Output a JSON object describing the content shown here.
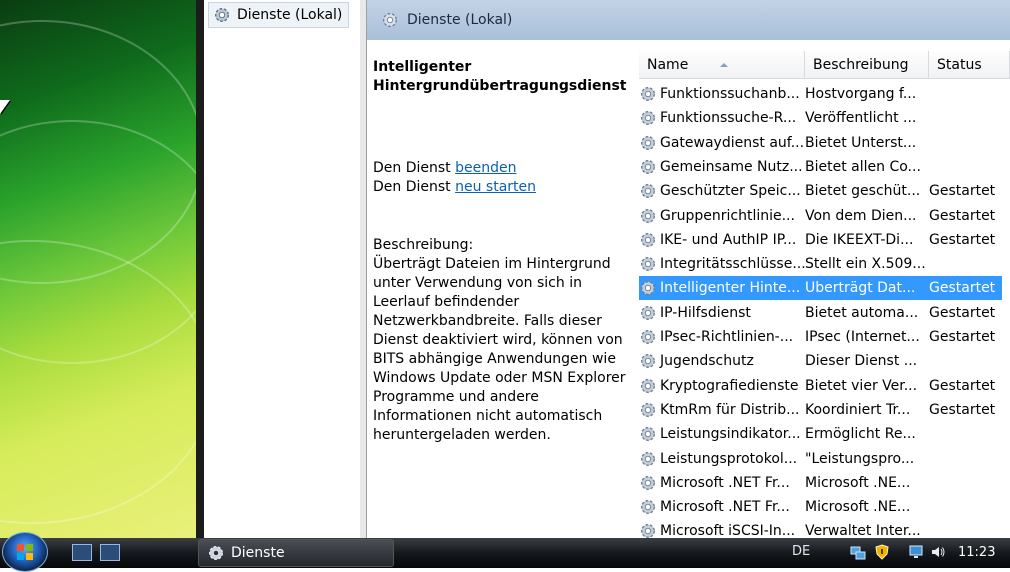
{
  "tree": {
    "root_label": "Dienste (Lokal)"
  },
  "main": {
    "header_title": "Dienste (Lokal)"
  },
  "info": {
    "title": "Intelligenter Hintergrundübertragungsdienst",
    "line1_prefix": "Den Dienst ",
    "line1_link": "beenden",
    "line2_prefix": "Den Dienst ",
    "line2_link": "neu starten",
    "desc_label": "Beschreibung:",
    "desc_text": "Überträgt Dateien im Hintergrund unter Verwendung von sich in Leerlauf befindender Netzwerkbandbreite. Falls dieser Dienst deaktiviert wird, können von BITS abhängige Anwendungen wie Windows Update oder MSN Explorer Programme und andere Informationen nicht automatisch heruntergeladen werden."
  },
  "list": {
    "columns": {
      "name": "Name",
      "description": "Beschreibung",
      "status": "Status"
    },
    "rows": [
      {
        "name": "Funktionssuchanb...",
        "description": "Hostvorgang f...",
        "status": ""
      },
      {
        "name": "Funktionssuche-R...",
        "description": "Veröffentlicht ...",
        "status": ""
      },
      {
        "name": "Gatewaydienst auf...",
        "description": "Bietet Unterst...",
        "status": ""
      },
      {
        "name": "Gemeinsame Nutz...",
        "description": "Bietet allen Co...",
        "status": ""
      },
      {
        "name": "Geschützter Speic...",
        "description": "Bietet geschüt...",
        "status": "Gestartet"
      },
      {
        "name": "Gruppenrichtlinie...",
        "description": "Von dem Dien...",
        "status": "Gestartet"
      },
      {
        "name": "IKE- und AuthIP IP...",
        "description": "Die IKEEXT-Di...",
        "status": "Gestartet"
      },
      {
        "name": "Integritätsschlüsse...",
        "description": "Stellt ein X.509...",
        "status": ""
      },
      {
        "name": "Intelligenter Hinte...",
        "description": "Überträgt Dat...",
        "status": "Gestartet",
        "selected": true
      },
      {
        "name": "IP-Hilfsdienst",
        "description": "Bietet automa...",
        "status": "Gestartet"
      },
      {
        "name": "IPsec-Richtlinien-...",
        "description": "IPsec (Internet...",
        "status": "Gestartet"
      },
      {
        "name": "Jugendschutz",
        "description": "Dieser Dienst ...",
        "status": ""
      },
      {
        "name": "Kryptografiedienste",
        "description": "Bietet vier Ver...",
        "status": "Gestartet"
      },
      {
        "name": "KtmRm für Distrib...",
        "description": "Koordiniert Tr...",
        "status": "Gestartet"
      },
      {
        "name": "Leistungsindikator...",
        "description": "Ermöglicht Re...",
        "status": ""
      },
      {
        "name": "Leistungsprotokol...",
        "description": "\"Leistungspro...",
        "status": ""
      },
      {
        "name": "Microsoft .NET Fr...",
        "description": "Microsoft .NE...",
        "status": ""
      },
      {
        "name": "Microsoft .NET Fr...",
        "description": "Microsoft .NE...",
        "status": ""
      },
      {
        "name": "Microsoft iSCSI-In...",
        "description": "Verwaltet Inter...",
        "status": ""
      }
    ]
  },
  "taskbar": {
    "task_label": "Dienste",
    "language": "DE",
    "clock": "11:23"
  },
  "icons": {
    "service": "gear-icon",
    "start": "windows-start-icon",
    "volume": "speaker-icon",
    "network": "network-icon",
    "security": "shield-icon"
  },
  "colors": {
    "selection": "#3399ff",
    "link": "#0b5fb5",
    "header": "#b7c9df"
  }
}
